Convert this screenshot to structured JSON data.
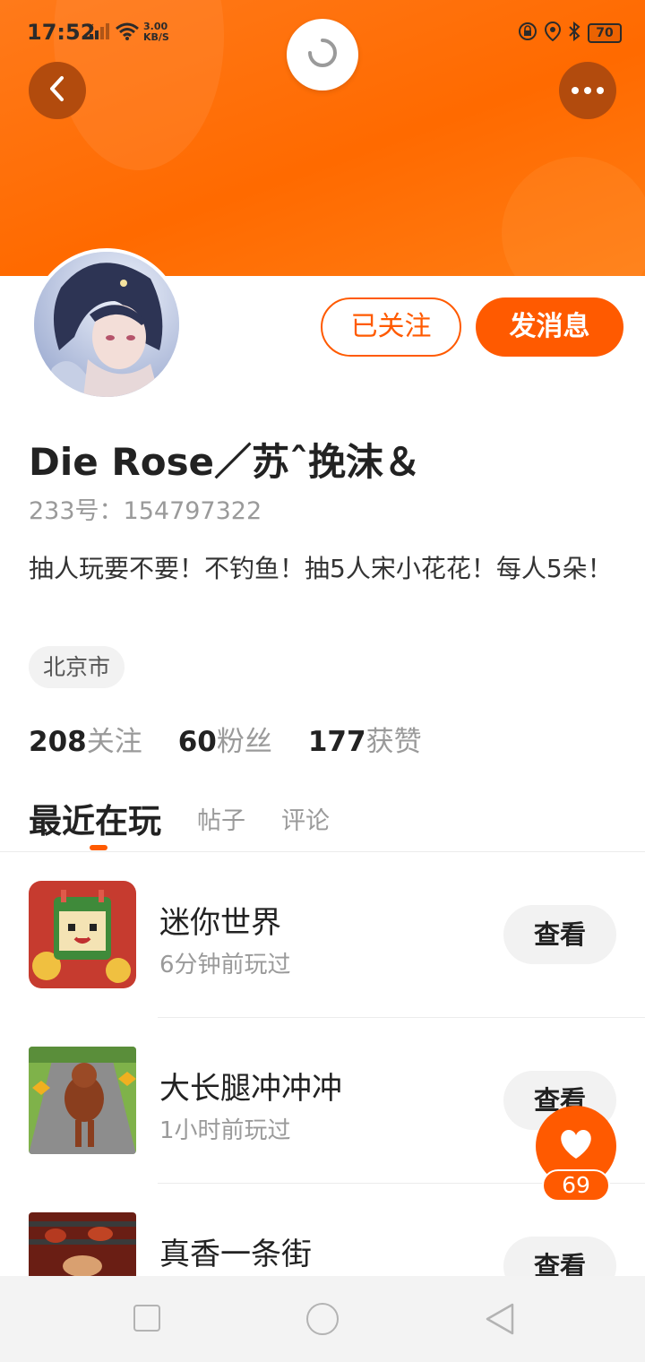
{
  "status_bar": {
    "time": "17:52",
    "net_speed_value": "3.00",
    "net_speed_unit": "KB/S",
    "battery": "70",
    "icons": [
      "signal-icon",
      "wifi-icon",
      "lock-rotation-icon",
      "location-icon",
      "bluetooth-icon",
      "battery-icon"
    ]
  },
  "header": {
    "back_icon": "chevron-left-icon",
    "refresh_icon": "refresh-icon",
    "more_icon": "more-dots-icon",
    "accent_color": "#ff6a00"
  },
  "profile": {
    "follow_label": "已关注",
    "message_label": "发消息",
    "name": "Die  Rose／苏ˆ挽沫＆",
    "uid": "233号：154797322",
    "bio": "抽人玩要不要！不钓鱼！抽5人宋小花花！每人5朵！",
    "location": "北京市"
  },
  "stats": [
    {
      "num": "208",
      "label": "关注"
    },
    {
      "num": "60",
      "label": "粉丝"
    },
    {
      "num": "177",
      "label": "获赞"
    }
  ],
  "tabs": [
    {
      "label": "最近在玩",
      "active": true
    },
    {
      "label": "帖子",
      "active": false
    },
    {
      "label": "评论",
      "active": false
    }
  ],
  "games": [
    {
      "name": "迷你世界",
      "time": "6分钟前玩过",
      "button": "查看"
    },
    {
      "name": "大长腿冲冲冲",
      "time": "1小时前玩过",
      "button": "查看"
    },
    {
      "name": "真香一条街",
      "time": "",
      "button": "查看"
    }
  ],
  "like": {
    "icon": "heart-icon",
    "count": "69"
  },
  "navbar": {
    "icons": [
      "recent-apps-icon",
      "home-icon",
      "back-icon"
    ]
  }
}
